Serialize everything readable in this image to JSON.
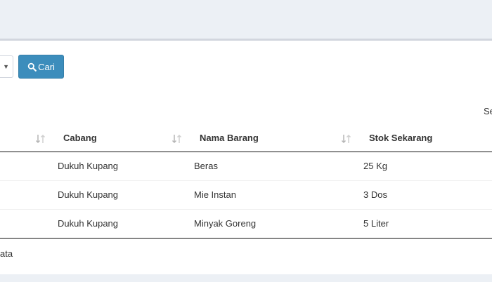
{
  "toolbar": {
    "search_button_label": "Cari",
    "search_icon": "search-icon"
  },
  "table_search": {
    "label_partial": "Se"
  },
  "table": {
    "columns": [
      {
        "label": "Cabang"
      },
      {
        "label": "Nama Barang"
      },
      {
        "label": "Stok Sekarang"
      }
    ],
    "rows": [
      {
        "cabang": "Dukuh Kupang",
        "nama_barang": "Beras",
        "stok": "25 Kg"
      },
      {
        "cabang": "Dukuh Kupang",
        "nama_barang": "Mie Instan",
        "stok": "3 Dos"
      },
      {
        "cabang": "Dukuh Kupang",
        "nama_barang": "Minyak Goreng",
        "stok": "5 Liter"
      }
    ]
  },
  "footer": {
    "info_partial": "ata"
  },
  "colors": {
    "primary": "#3c8dbc",
    "background": "#ecf0f5"
  }
}
